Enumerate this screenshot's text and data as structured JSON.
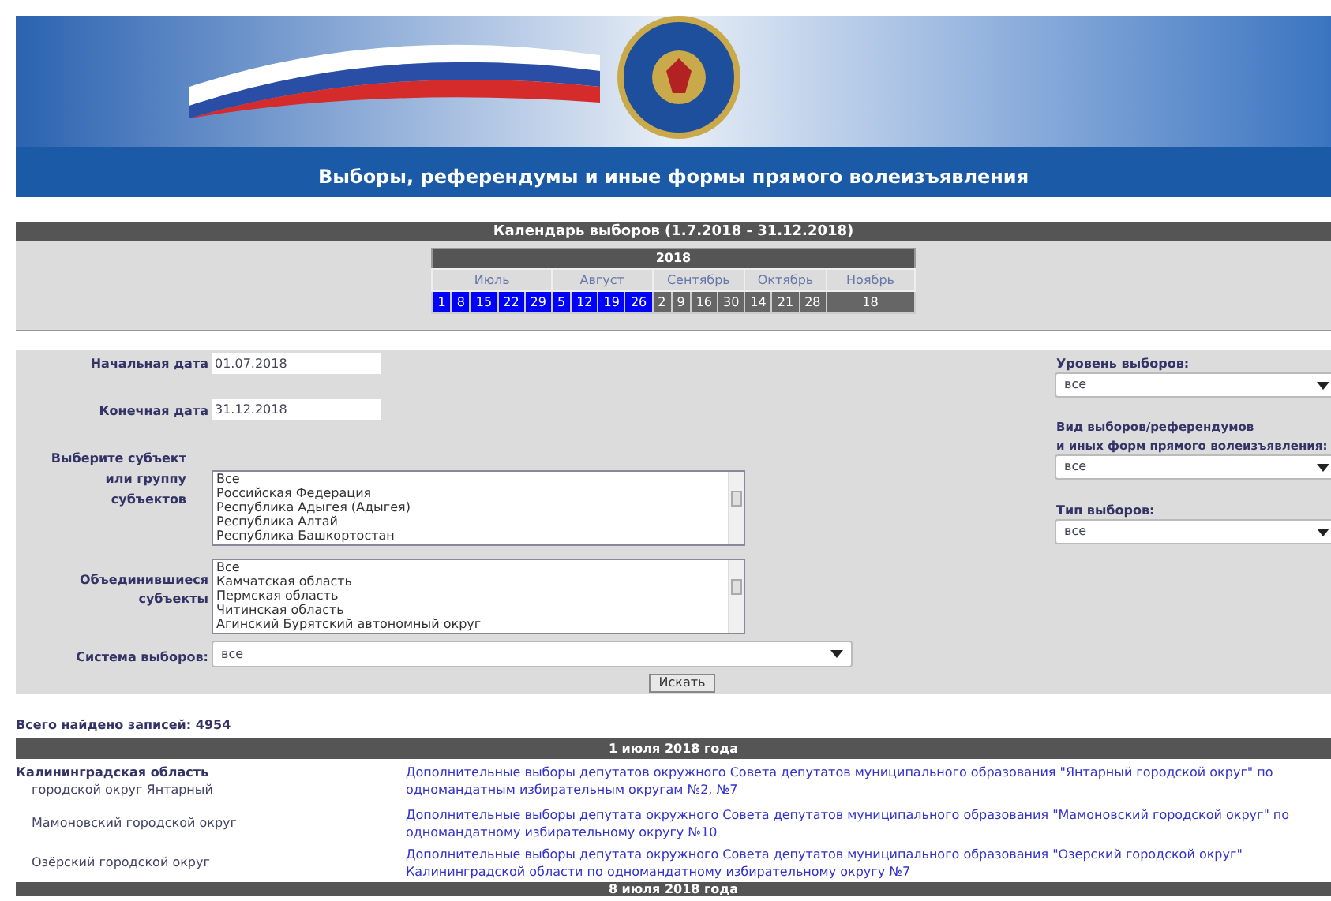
{
  "banner": {
    "title": "Выборы, референдумы и иные формы прямого волеизъявления"
  },
  "calendar": {
    "title": "Календарь выборов (1.7.2018 - 31.12.2018)",
    "year": "2018",
    "months": [
      {
        "name": "Июль",
        "days": [
          {
            "label": "1",
            "highlighted": true
          },
          {
            "label": "8",
            "highlighted": true
          },
          {
            "label": "15",
            "highlighted": true
          },
          {
            "label": "22",
            "highlighted": true
          },
          {
            "label": "29",
            "highlighted": true
          }
        ]
      },
      {
        "name": "Август",
        "days": [
          {
            "label": "5",
            "highlighted": true
          },
          {
            "label": "12",
            "highlighted": true
          },
          {
            "label": "19",
            "highlighted": true
          },
          {
            "label": "26",
            "highlighted": true
          }
        ]
      },
      {
        "name": "Сентябрь",
        "days": [
          {
            "label": "2",
            "highlighted": false
          },
          {
            "label": "9",
            "highlighted": false
          },
          {
            "label": "16",
            "highlighted": false
          },
          {
            "label": "30",
            "highlighted": false
          }
        ]
      },
      {
        "name": "Октябрь",
        "days": [
          {
            "label": "14",
            "highlighted": false
          },
          {
            "label": "21",
            "highlighted": false
          },
          {
            "label": "28",
            "highlighted": false
          }
        ]
      },
      {
        "name": "Ноябрь",
        "days": [
          {
            "label": "18",
            "highlighted": false
          }
        ]
      }
    ]
  },
  "form": {
    "start_date": {
      "label": "Начальная дата",
      "value": "01.07.2018"
    },
    "end_date": {
      "label": "Конечная дата",
      "value": "31.12.2018"
    },
    "subjects": {
      "label": "Выберите субъект или группу субъектов",
      "options": [
        "Все",
        "Российская Федерация",
        "Республика Адыгея (Адыгея)",
        "Республика Алтай",
        "Республика Башкортостан"
      ]
    },
    "merged_subjects": {
      "label": "Объединившиеся субъекты",
      "options": [
        "Все",
        "Камчатская область",
        "Пермская область",
        "Читинская область",
        "Агинский Бурятский автономный округ"
      ]
    },
    "system": {
      "label": "Система выборов:",
      "value": "все"
    },
    "search_button": "Искать",
    "level": {
      "label": "Уровень выборов:",
      "value": "все"
    },
    "kind": {
      "label": "Вид выборов/референдумов\nи иных форм прямого волеизъявления:",
      "value": "все"
    },
    "type": {
      "label": "Тип выборов:",
      "value": "все"
    }
  },
  "results": {
    "total": "Всего найдено записей: 4954",
    "groups": [
      {
        "date": "1 июля 2018 года",
        "region": "Калининградская область",
        "rows": [
          {
            "place": "городской округ Янтарный",
            "election": "Дополнительные выборы депутатов окружного Совета депутатов муниципального образования \"Янтарный городской округ\" по одномандатным избирательным округам №2, №7"
          },
          {
            "place": "Мамоновский городской округ",
            "election": "Дополнительные выборы депутата окружного Совета депутатов муниципального образования \"Мамоновский городской округ\" по одномандатному избирательному округу №10"
          },
          {
            "place": "Озёрский городской округ",
            "election": "Дополнительные выборы депутата окружного Совета депутатов муниципального образования \"Озерский городской округ\" Калининградской области по одномандатному избирательному округу №7"
          }
        ]
      },
      {
        "date": "8 июля 2018 года"
      }
    ]
  }
}
